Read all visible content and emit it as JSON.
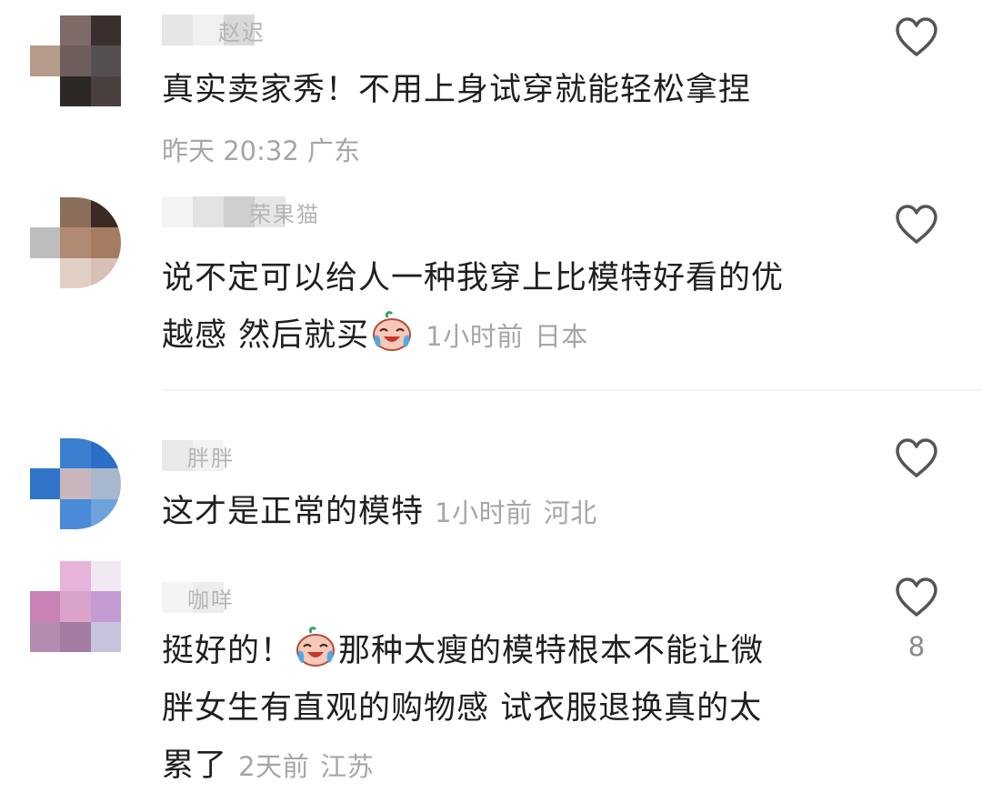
{
  "comments": [
    {
      "username": "赵迟",
      "text": "真实卖家秀！不用上身试穿就能轻松拿捏",
      "time": "昨天 20:32",
      "location": "广东",
      "likes": ""
    },
    {
      "username": "荣果猫",
      "text_line1": "说不定可以给人一种我穿上比模特好看的优",
      "text_line2": "越感 然后就买",
      "time": "1小时前",
      "location": "日本",
      "emoji": "crying-laughing-emoji",
      "likes": ""
    },
    {
      "username": "胖胖",
      "text": "这才是正常的模特",
      "time": "1小时前",
      "location": "河北",
      "likes": ""
    },
    {
      "username": "咖咩",
      "text_line1_a": "挺好的！",
      "text_line1_b": "那种太瘦的模特根本不能让微",
      "text_line2": "胖女生有直观的购物感 试衣服退换真的太",
      "text_line3": "累了",
      "time": "2天前",
      "location": "江苏",
      "emoji": "crying-laughing-emoji",
      "likes": "8"
    }
  ],
  "icons": {
    "like": "heart-outline-icon"
  },
  "colors": {
    "text": "#1f1f1f",
    "meta": "#a6a6a6",
    "icon": "#555555"
  }
}
